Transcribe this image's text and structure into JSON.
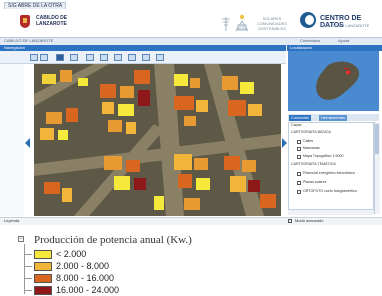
{
  "browser_tab": {
    "label": "SIG ABRE DE LA OTRA"
  },
  "header": {
    "government_name": "CABILDO DE\nLANZAROTE",
    "paneles_text": "SOLARES COMUNIDADES\nSOSTENIBLES",
    "centro_de_datos_title": "CENTRO DE DATOS",
    "centro_de_datos_sub": "CABILDO DE LANZAROTE"
  },
  "subnav": {
    "breadcrumb": "CABILDO DE LANZAROTE",
    "link_a": "Contenidos",
    "link_b": "Ayuda"
  },
  "map_panel": {
    "title": "Navegación"
  },
  "side_panel": {
    "title": "Localización",
    "tabs": [
      "Contenido",
      "Herramientas"
    ],
    "controls": [
      {
        "label": "Capas",
        "type": "text"
      },
      {
        "label": "CARTOGRAFÍA BÁSICA",
        "type": "group"
      },
      {
        "label": "Calles",
        "type": "checkbox"
      },
      {
        "label": "Manzanas",
        "type": "checkbox"
      },
      {
        "label": "Mapa Topográfico 1:5000",
        "type": "checkbox"
      },
      {
        "label": "CARTOGRAFÍA TEMÁTICA",
        "type": "group"
      },
      {
        "label": "Potencial energético fotovoltaico",
        "type": "checkbox"
      },
      {
        "label": "Placas solares",
        "type": "checkbox"
      },
      {
        "label": "ORTOFOTO vuelo fotogramétrico",
        "type": "checkbox"
      }
    ]
  },
  "status": {
    "left_label": "Leyenda",
    "right_label": "Modo avanzado"
  },
  "legend": {
    "title": "Producción de potencia anual (Kw.)",
    "items": [
      {
        "label": "< 2.000",
        "color": "#f5ea3c"
      },
      {
        "label": "2.000 - 8.000",
        "color": "#f2b53a"
      },
      {
        "label": "8.000 - 16.000",
        "color": "#d9661f"
      },
      {
        "label": "16.000 - 24.000",
        "color": "#8e1717"
      }
    ]
  },
  "colors": {
    "accent": "#2c73c4",
    "brand_dark": "#1f3d6b"
  }
}
